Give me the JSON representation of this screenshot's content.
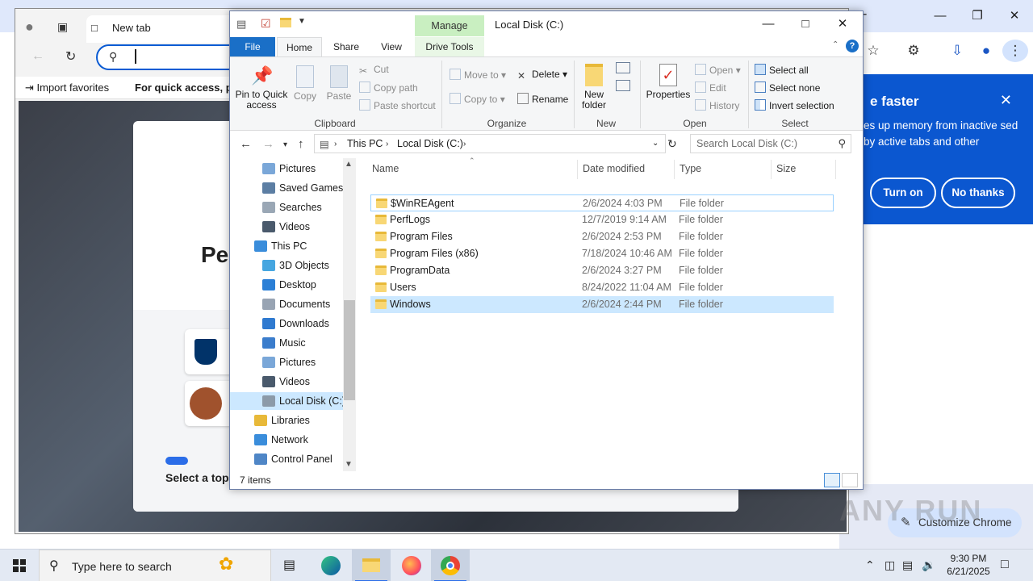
{
  "chrome": {
    "promo": {
      "title": "e faster",
      "body": "es up memory from inactive sed by active tabs and other",
      "turn_on": "Turn on",
      "no_thanks": "No thanks"
    },
    "customize": "Customize Chrome"
  },
  "edge": {
    "tab_title": "New tab",
    "favorites": [
      "Import favorites",
      "For quick access, plac"
    ],
    "page_heading": "Per",
    "select_topic": "Select a topic"
  },
  "explorer": {
    "title": "Local Disk (C:)",
    "manage_tab": "Manage",
    "tabs": [
      "File",
      "Home",
      "Share",
      "View",
      "Drive Tools"
    ],
    "ribbon": {
      "clipboard": {
        "label": "Clipboard",
        "pin": "Pin to Quick access",
        "copy": "Copy",
        "paste": "Paste",
        "cut": "Cut",
        "copy_path": "Copy path",
        "paste_shortcut": "Paste shortcut"
      },
      "organize": {
        "label": "Organize",
        "move_to": "Move to",
        "copy_to": "Copy to",
        "delete": "Delete",
        "rename": "Rename"
      },
      "new": {
        "label": "New",
        "new_folder": "New folder"
      },
      "open": {
        "label": "Open",
        "properties": "Properties",
        "open": "Open",
        "edit": "Edit",
        "history": "History"
      },
      "select": {
        "label": "Select",
        "select_all": "Select all",
        "select_none": "Select none",
        "invert": "Invert selection"
      }
    },
    "breadcrumb": [
      "This PC",
      "Local Disk (C:)"
    ],
    "search_placeholder": "Search Local Disk (C:)",
    "tree": [
      {
        "label": "Pictures",
        "icon": "pictures-icon",
        "color": "#7aa7d8"
      },
      {
        "label": "Saved Games",
        "icon": "saved-games-icon",
        "color": "#5c7ea3"
      },
      {
        "label": "Searches",
        "icon": "searches-icon",
        "color": "#9aa7b5"
      },
      {
        "label": "Videos",
        "icon": "videos-icon",
        "color": "#4a5a6c"
      },
      {
        "label": "This PC",
        "icon": "computer-icon",
        "color": "#3a8ddb"
      },
      {
        "label": "3D Objects",
        "icon": "3d-objects-icon",
        "color": "#46a6e0"
      },
      {
        "label": "Desktop",
        "icon": "desktop-icon",
        "color": "#2b7fd6"
      },
      {
        "label": "Documents",
        "icon": "documents-icon",
        "color": "#98a4b3"
      },
      {
        "label": "Downloads",
        "icon": "downloads-icon",
        "color": "#2f7ad0"
      },
      {
        "label": "Music",
        "icon": "music-icon",
        "color": "#3b7dcc"
      },
      {
        "label": "Pictures",
        "icon": "pictures-icon",
        "color": "#7aa7d8"
      },
      {
        "label": "Videos",
        "icon": "videos-icon",
        "color": "#4a5a6c"
      },
      {
        "label": "Local Disk (C:)",
        "icon": "drive-icon",
        "color": "#8c9aa8"
      },
      {
        "label": "Libraries",
        "icon": "libraries-icon",
        "color": "#e8b939"
      },
      {
        "label": "Network",
        "icon": "network-icon",
        "color": "#3a8ddb"
      },
      {
        "label": "Control Panel",
        "icon": "control-panel-icon",
        "color": "#4f86c6"
      }
    ],
    "columns": [
      "Name",
      "Date modified",
      "Type",
      "Size"
    ],
    "files": [
      {
        "name": "$WinREAgent",
        "date": "2/6/2024 4:03 PM",
        "type": "File folder"
      },
      {
        "name": "PerfLogs",
        "date": "12/7/2019 9:14 AM",
        "type": "File folder"
      },
      {
        "name": "Program Files",
        "date": "2/6/2024 2:53 PM",
        "type": "File folder"
      },
      {
        "name": "Program Files (x86)",
        "date": "7/18/2024 10:46 AM",
        "type": "File folder"
      },
      {
        "name": "ProgramData",
        "date": "2/6/2024 3:27 PM",
        "type": "File folder"
      },
      {
        "name": "Users",
        "date": "8/24/2022 11:04 AM",
        "type": "File folder"
      },
      {
        "name": "Windows",
        "date": "2/6/2024 2:44 PM",
        "type": "File folder"
      }
    ],
    "status": "7 items"
  },
  "taskbar": {
    "search_placeholder": "Type here to search",
    "time": "9:30 PM",
    "date": "6/21/2025"
  },
  "watermark": "ANY RUN"
}
